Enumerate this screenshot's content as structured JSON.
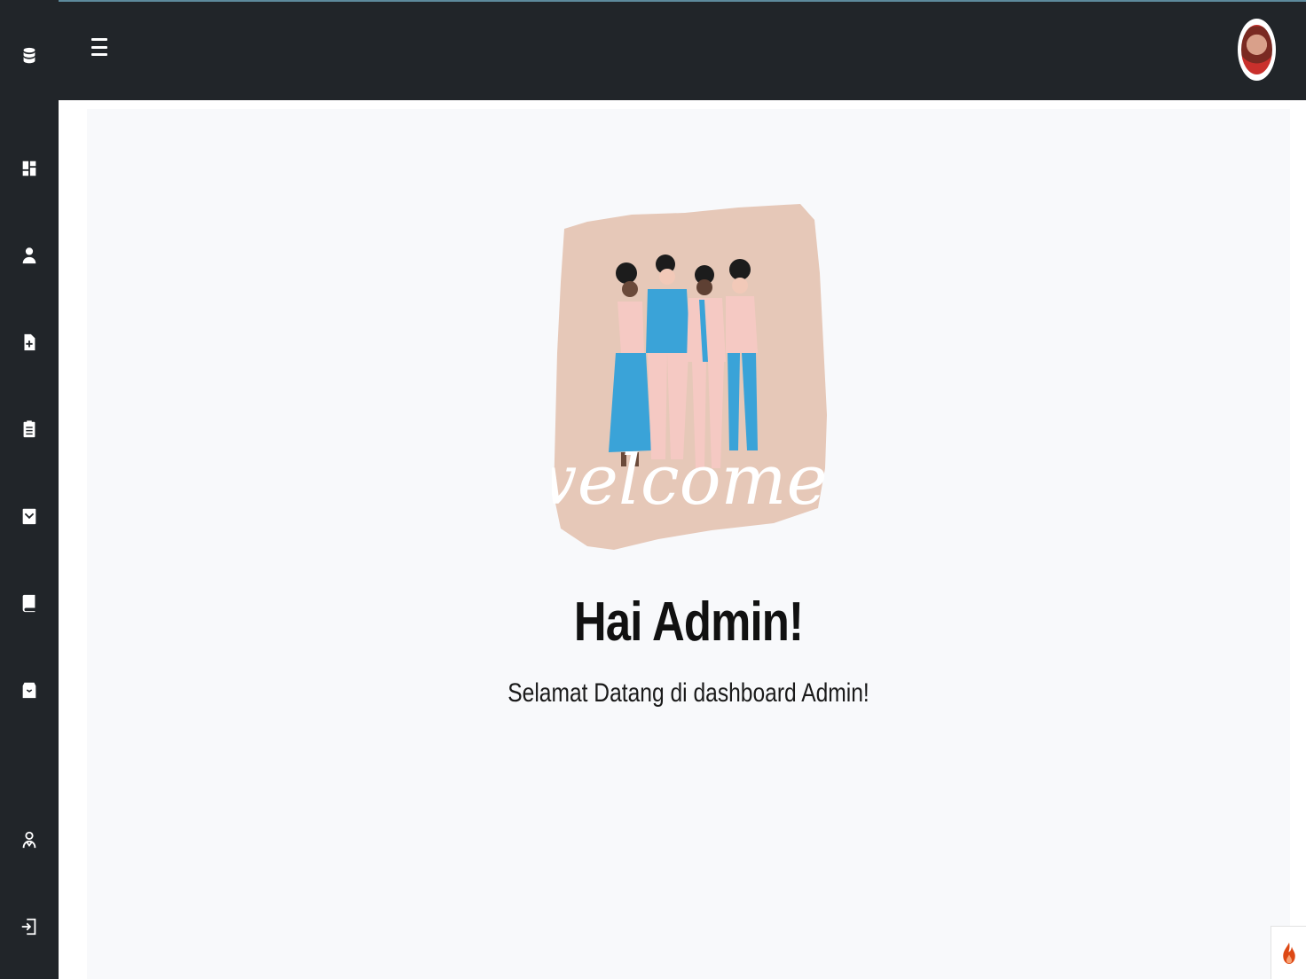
{
  "greeting": {
    "title": "Hai Admin!",
    "subtitle": "Selamat Datang di dashboard Admin!"
  },
  "illustration": {
    "text": "welcome!",
    "bg_color": "#e6c8b8",
    "accent_color": "#3aa3d8",
    "secondary_color": "#f5c9c3"
  },
  "sidebar": {
    "items": [
      {
        "icon": "database-icon"
      },
      {
        "icon": "dashboard-icon"
      },
      {
        "icon": "user-icon"
      },
      {
        "icon": "file-medical-icon"
      },
      {
        "icon": "clipboard-list-icon"
      },
      {
        "icon": "calendar-check-icon"
      },
      {
        "icon": "book-icon"
      },
      {
        "icon": "archive-icon"
      },
      {
        "icon": "user-doctor-icon"
      },
      {
        "icon": "logout-icon"
      }
    ]
  },
  "colors": {
    "sidebar_bg": "#212529",
    "page_bg": "#f8f9fb",
    "icon_color": "#ffffff"
  }
}
